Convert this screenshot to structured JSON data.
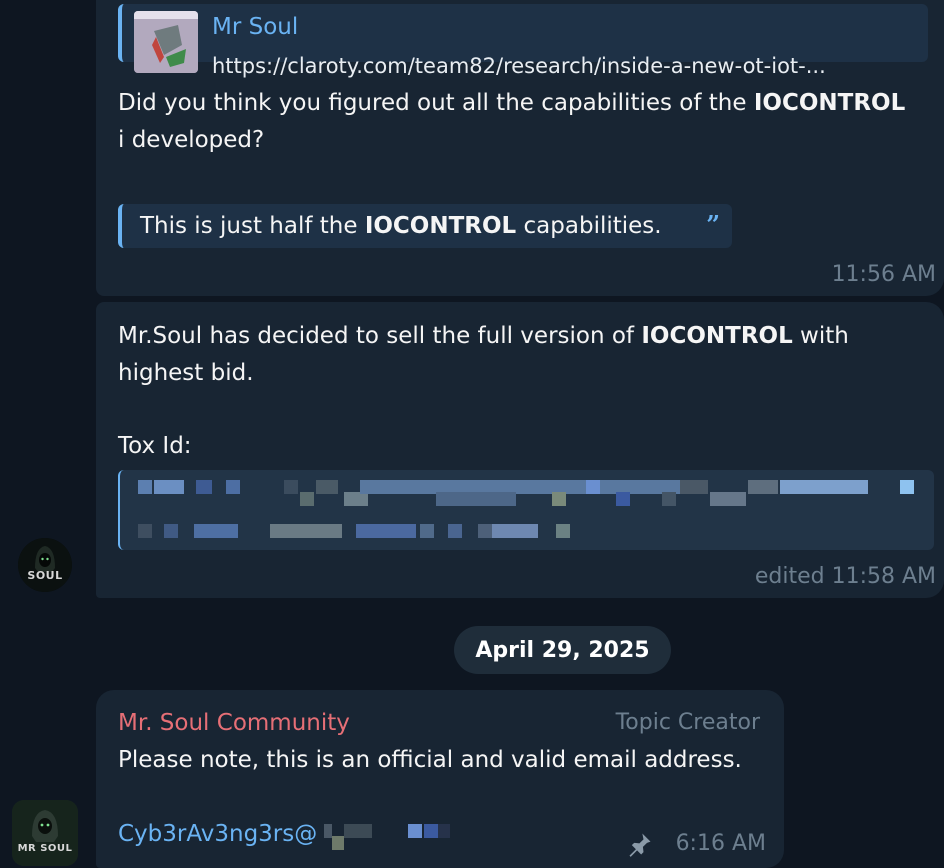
{
  "messages": [
    {
      "reply": {
        "name": "Mr Soul",
        "text": "https://claroty.com/team82/research/inside-a-new-ot-iot-..."
      },
      "text_line1_a": "Did you think you figured out all the capabilities of the ",
      "text_line1_bold": "IOCONTROL",
      "text_line2": "i developed?",
      "quote_a": "This is just half the ",
      "quote_bold": "IOCONTROL",
      "quote_b": " capabilities.",
      "quote_mark": "”",
      "time": "11:56 AM"
    },
    {
      "text_line1_a": "Mr.Soul has decided to sell the full version of ",
      "text_line1_bold": "IOCONTROL",
      "text_line1_b": " with",
      "text_line2": "highest bid.",
      "text_line3": "Tox Id:",
      "time": "edited 11:58 AM",
      "avatar_label": "SOUL"
    },
    {
      "sender": "Mr. Soul Community",
      "role": "Topic Creator",
      "text": "Please note, this is an official and valid email address.",
      "email": "Cyb3rAv3ng3rs@",
      "time": "6:16 AM",
      "avatar_label": "MR SOUL"
    }
  ],
  "date_separator": "April 29, 2025",
  "colors": {
    "background": "#0e1621",
    "bubble": "#182533",
    "accent": "#6ab3f3",
    "sender_name": "#e66f76",
    "muted": "#6d7f8f"
  }
}
